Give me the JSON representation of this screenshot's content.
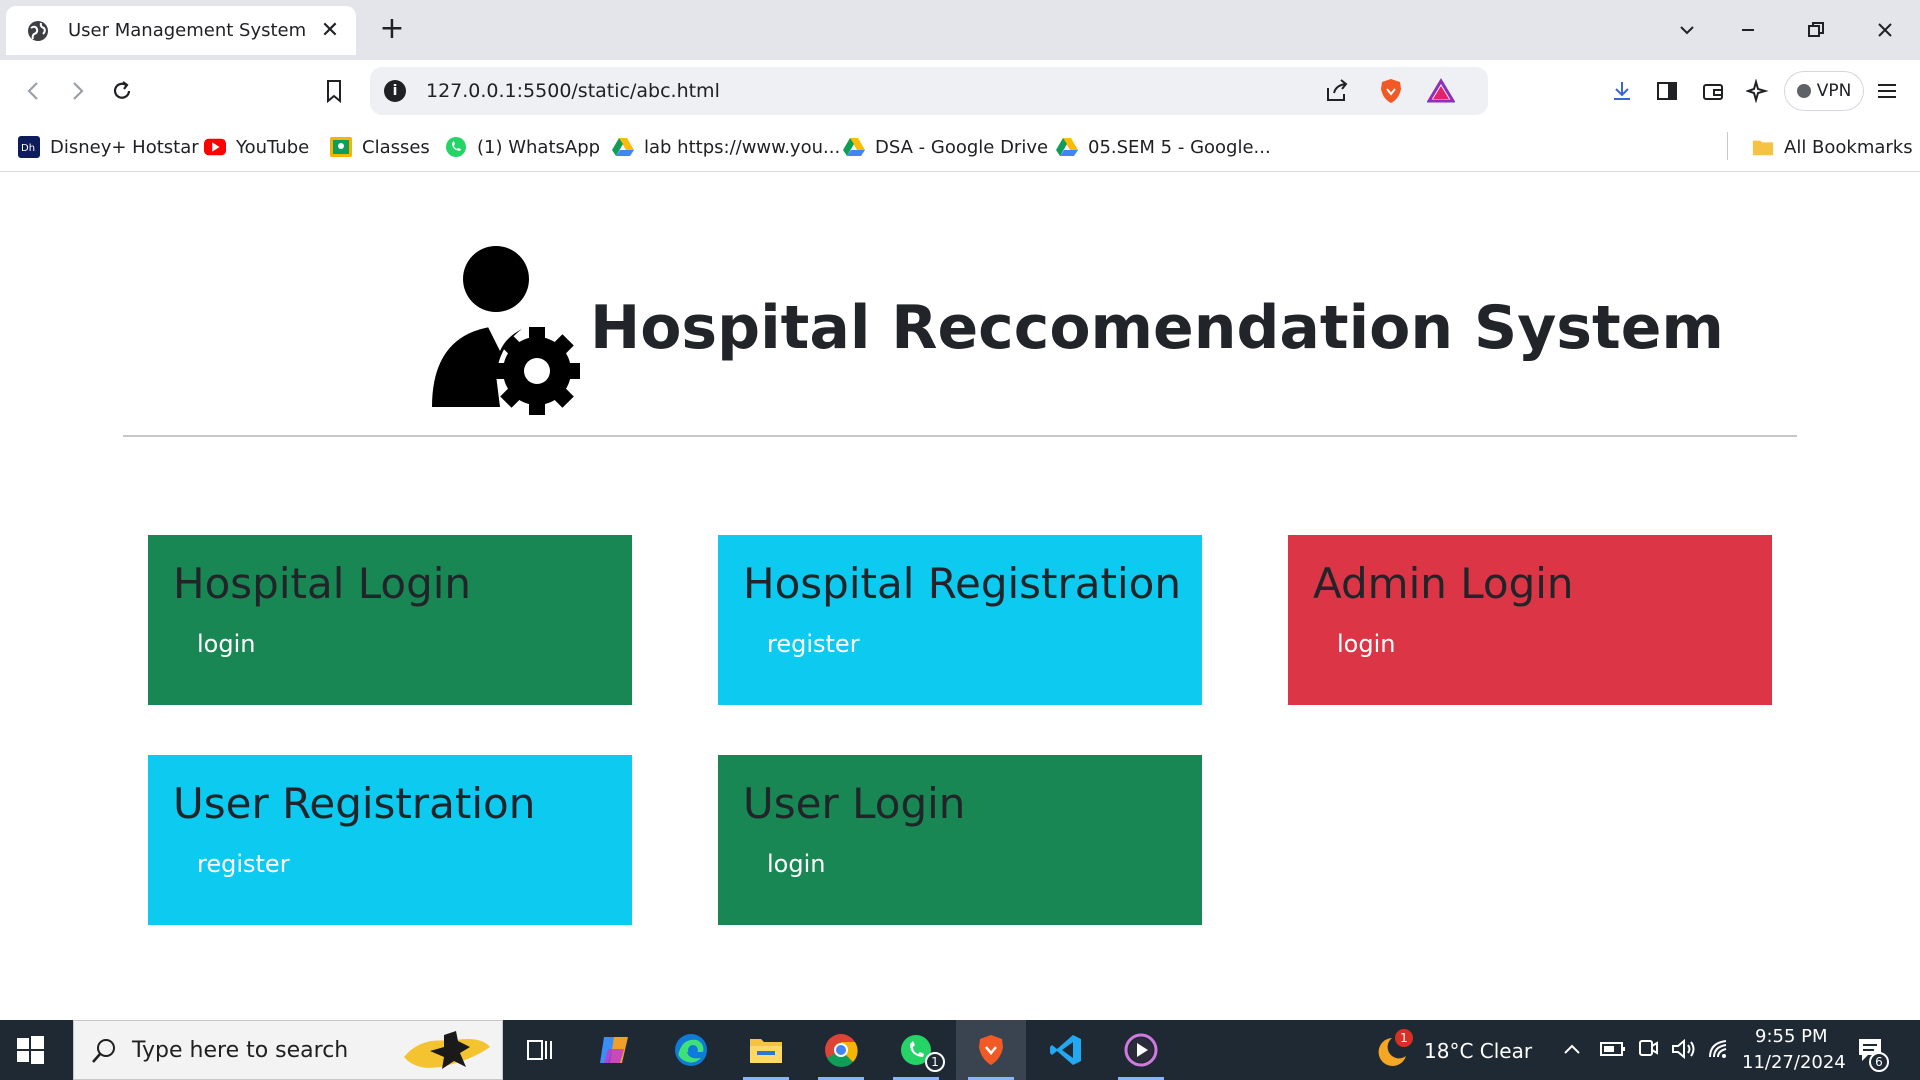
{
  "browser": {
    "tab_title": "User Management System",
    "url": "127.0.0.1:5500/static/abc.html",
    "vpn_label": "VPN",
    "bookmarks": [
      {
        "label": "Disney+ Hotstar",
        "icon": "hotstar-icon"
      },
      {
        "label": "YouTube",
        "icon": "youtube-icon"
      },
      {
        "label": "Classes",
        "icon": "classroom-icon"
      },
      {
        "label": "(1) WhatsApp",
        "icon": "whatsapp-icon"
      },
      {
        "label": "lab https://www.you...",
        "icon": "drive-icon"
      },
      {
        "label": "DSA - Google Drive",
        "icon": "drive-icon"
      },
      {
        "label": "05.SEM 5 - Google...",
        "icon": "drive-icon"
      }
    ],
    "all_bookmarks": "All Bookmarks"
  },
  "page": {
    "title": "Hospital Reccomendation System",
    "cards": [
      {
        "title": "Hospital Login",
        "link": "login",
        "color": "#198754"
      },
      {
        "title": "Hospital Registration",
        "link": "register",
        "color": "#0dcaf0"
      },
      {
        "title": "Admin Login",
        "link": "login",
        "color": "#dc3545"
      },
      {
        "title": "User Registration",
        "link": "register",
        "color": "#0dcaf0"
      },
      {
        "title": "User Login",
        "link": "login",
        "color": "#198754"
      }
    ]
  },
  "taskbar": {
    "search_placeholder": "Type here to search",
    "weather": "18°C  Clear",
    "weather_badge": "1",
    "time": "9:55 PM",
    "date": "11/27/2024",
    "whatsapp_badge": "1",
    "notification_count": "6"
  }
}
